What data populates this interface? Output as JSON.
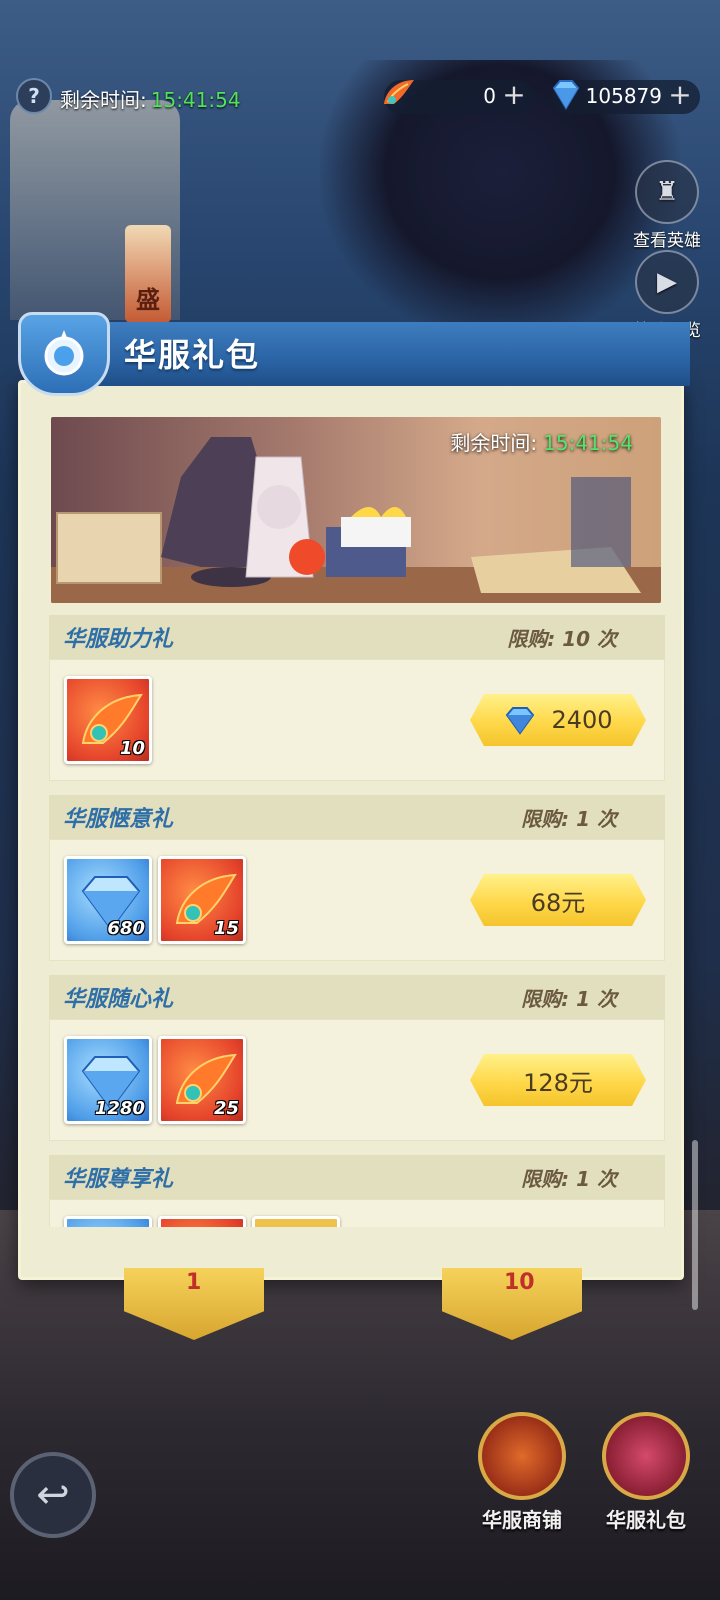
{
  "hud": {
    "remain_label": "剩余时间:",
    "remain_time": "15:41:54",
    "help_symbol": "?",
    "resource_feather": "0",
    "resource_gem": "105879",
    "plus_symbol": "+"
  },
  "side": {
    "view_hero": "查看英雄",
    "battle_preview": "战斗预览"
  },
  "bg": {
    "sign_char": "盛"
  },
  "panel": {
    "title": "华服礼包",
    "banner_remain_label": "剩余时间:",
    "banner_remain_time": "15:41:54",
    "packs": [
      {
        "name": "华服助力礼",
        "limit": "限购: 10 次",
        "items": [
          {
            "icon": "feather-mask-icon",
            "count": "10"
          }
        ],
        "price": "2400",
        "price_icon": "gem-icon"
      },
      {
        "name": "华服惬意礼",
        "limit": "限购: 1 次",
        "items": [
          {
            "icon": "gem-icon",
            "count": "680"
          },
          {
            "icon": "feather-mask-icon",
            "count": "15"
          }
        ],
        "price": "68元"
      },
      {
        "name": "华服随心礼",
        "limit": "限购: 1 次",
        "items": [
          {
            "icon": "gem-icon",
            "count": "1280"
          },
          {
            "icon": "feather-mask-icon",
            "count": "25"
          }
        ],
        "price": "128元"
      },
      {
        "name": "华服尊享礼",
        "limit": "限购: 1 次"
      }
    ]
  },
  "bottom": {
    "tab_left_count": "1",
    "tab_right_count": "10",
    "shop_label": "华服商铺",
    "gift_label": "华服礼包"
  },
  "colors": {
    "timer_green": "#4fe35c",
    "pack_title_blue": "#2f6fa7",
    "price_gold": "#ffd84a"
  }
}
